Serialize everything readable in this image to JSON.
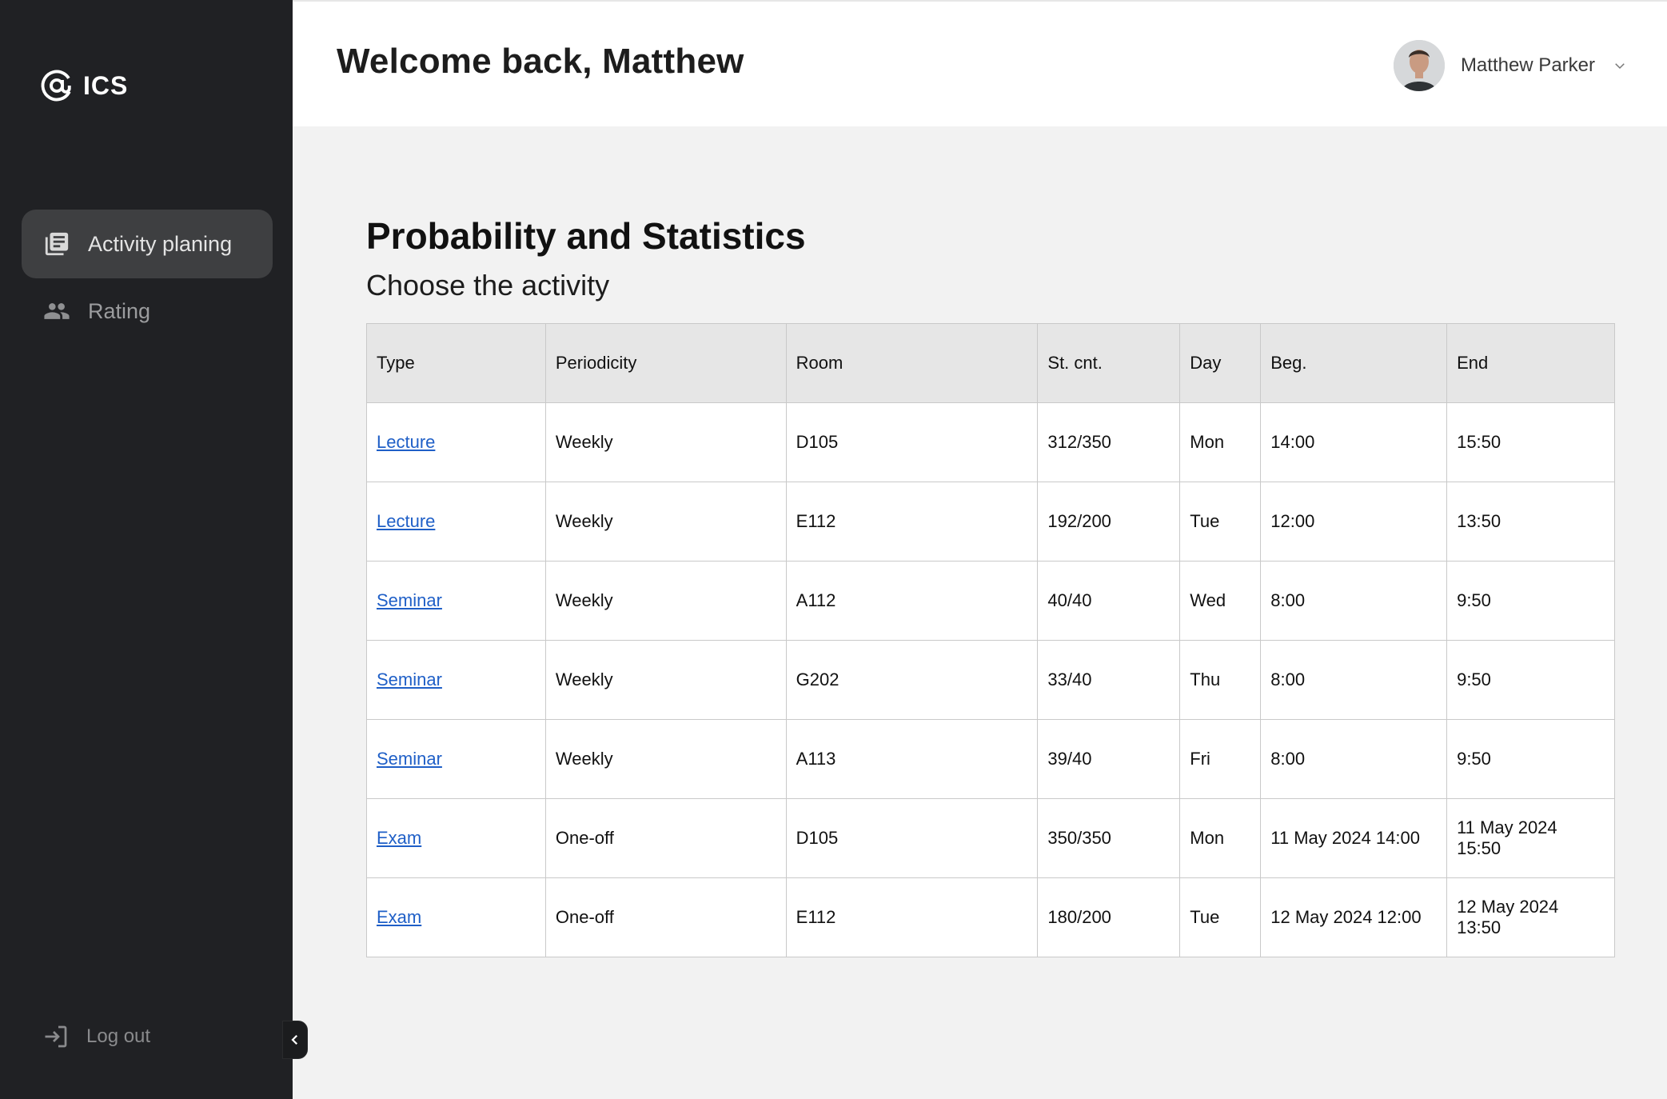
{
  "app": {
    "logo_text": "ICS"
  },
  "sidebar": {
    "items": [
      {
        "label": "Activity planing",
        "icon": "library-books-icon",
        "active": true
      },
      {
        "label": "Rating",
        "icon": "people-icon",
        "active": false
      }
    ],
    "logout_label": "Log out"
  },
  "header": {
    "welcome": "Welcome back, Matthew",
    "user_name": "Matthew Parker"
  },
  "main": {
    "title": "Probability and Statistics",
    "subtitle": "Choose the activity",
    "table": {
      "headers": [
        "Type",
        "Periodicity",
        "Room",
        "St. cnt.",
        "Day",
        "Beg.",
        "End"
      ],
      "rows": [
        [
          "Lecture",
          "Weekly",
          "D105",
          "312/350",
          "Mon",
          "14:00",
          "15:50"
        ],
        [
          "Lecture",
          "Weekly",
          "E112",
          "192/200",
          "Tue",
          "12:00",
          "13:50"
        ],
        [
          "Seminar",
          "Weekly",
          "A112",
          "40/40",
          "Wed",
          "8:00",
          "9:50"
        ],
        [
          "Seminar",
          "Weekly",
          "G202",
          "33/40",
          "Thu",
          "8:00",
          "9:50"
        ],
        [
          "Seminar",
          "Weekly",
          "A113",
          "39/40",
          "Fri",
          "8:00",
          "9:50"
        ],
        [
          "Exam",
          "One-off",
          "D105",
          "350/350",
          "Mon",
          "11 May 2024 14:00",
          "11 May 2024 15:50"
        ],
        [
          "Exam",
          "One-off",
          "E112",
          "180/200",
          "Tue",
          "12 May 2024 12:00",
          "12 May 2024 13:50"
        ]
      ]
    }
  },
  "colors": {
    "sidebar_bg": "#202124",
    "active_item_bg": "#3e3f41",
    "link": "#1f5fc7",
    "page_bg": "#f2f2f2"
  }
}
